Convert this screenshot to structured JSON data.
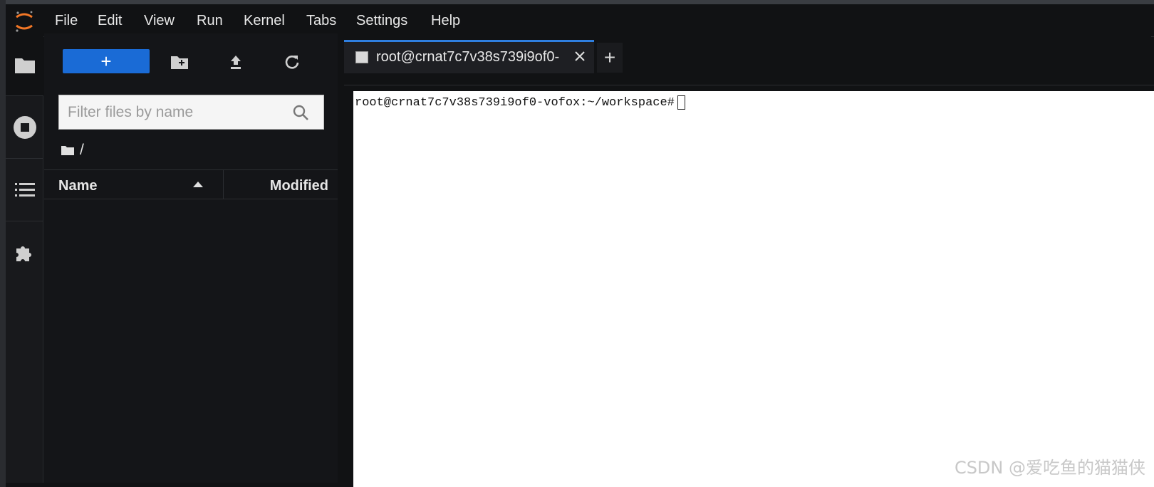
{
  "menubar": {
    "items": [
      "File",
      "Edit",
      "View",
      "Run",
      "Kernel",
      "Tabs",
      "Settings",
      "Help"
    ]
  },
  "rail": {
    "items": [
      {
        "icon": "folder-icon"
      },
      {
        "icon": "running-stop-icon"
      },
      {
        "icon": "table-of-contents-icon"
      },
      {
        "icon": "extension-puzzle-icon"
      }
    ]
  },
  "browser": {
    "new_label": "+",
    "filter_placeholder": "Filter files by name",
    "breadcrumb": "/",
    "columns": {
      "name": "Name",
      "modified": "Modified"
    },
    "files": []
  },
  "tabs": [
    {
      "label": "root@crnat7c7v38s739i9of0-",
      "active": true
    }
  ],
  "tab_add_label": "+",
  "terminal": {
    "prompt": "root@crnat7c7v38s739i9of0-vofox:~/workspace#"
  },
  "watermark": "CSDN @爱吃鱼的猫猫侠",
  "colors": {
    "accent": "#1a6bd6",
    "tab_highlight": "#2f7fe0",
    "logo_orange": "#f37726",
    "background": "#111214"
  }
}
